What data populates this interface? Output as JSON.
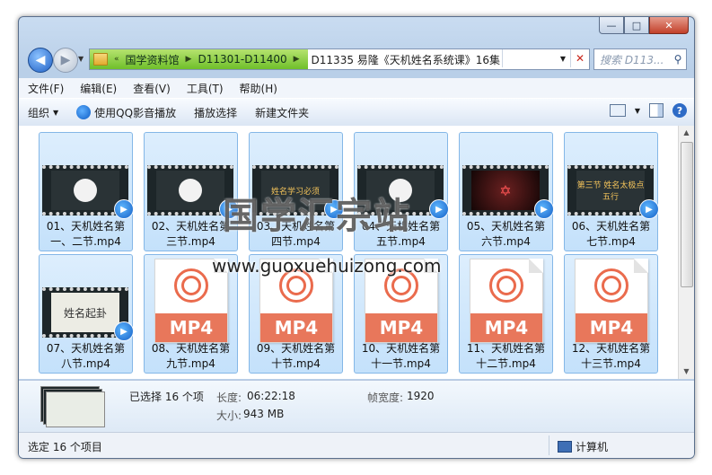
{
  "window": {
    "caption_buttons": {
      "minimize": "—",
      "maximize": "□",
      "close": "✕"
    }
  },
  "nav": {
    "back_glyph": "◀",
    "forward_glyph": "▶",
    "history_dropdown": "▼"
  },
  "address": {
    "crumbs": [
      "国学资料馆",
      "D11301-D11400"
    ],
    "prefix": "«",
    "separator": "▶",
    "current": "D11335 易隆《天机姓名系统课》16集",
    "dropdown": "▼",
    "refresh": "✕"
  },
  "search": {
    "placeholder": "搜索 D113...",
    "icon": "search-icon"
  },
  "menu": [
    "文件(F)",
    "编辑(E)",
    "查看(V)",
    "工具(T)",
    "帮助(H)"
  ],
  "toolbar": {
    "organize": "组织",
    "play_qq": "使用QQ影音播放",
    "play_selection": "播放选择",
    "new_folder": "新建文件夹",
    "caret": "▼",
    "help": "?"
  },
  "files": [
    {
      "line1": "01、天机姓名第",
      "line2": "一、二节.mp4",
      "thumb": "circle"
    },
    {
      "line1": "02、天机姓名第",
      "line2": "三节.mp4",
      "thumb": "circle"
    },
    {
      "line1": "03、天机姓名第",
      "line2": "四节.mp4",
      "thumb": "text",
      "thumb_text": "姓名学习必须"
    },
    {
      "line1": "04、天机姓名第",
      "line2": "五节.mp4",
      "thumb": "circle"
    },
    {
      "line1": "05、天机姓名第",
      "line2": "六节.mp4",
      "thumb": "star",
      "thumb_text": "✡"
    },
    {
      "line1": "06、天机姓名第",
      "line2": "七节.mp4",
      "thumb": "text",
      "thumb_text": "第三节 姓名太极点五行"
    },
    {
      "line1": "07、天机姓名第",
      "line2": "八节.mp4",
      "thumb": "light",
      "thumb_text": "姓名起卦"
    },
    {
      "line1": "08、天机姓名第",
      "line2": "九节.mp4",
      "thumb": "mp4",
      "thumb_text": "MP4"
    },
    {
      "line1": "09、天机姓名第",
      "line2": "十节.mp4",
      "thumb": "mp4",
      "thumb_text": "MP4"
    },
    {
      "line1": "10、天机姓名第",
      "line2": "十一节.mp4",
      "thumb": "mp4",
      "thumb_text": "MP4"
    },
    {
      "line1": "11、天机姓名第",
      "line2": "十二节.mp4",
      "thumb": "mp4",
      "thumb_text": "MP4"
    },
    {
      "line1": "12、天机姓名第",
      "line2": "十三节.mp4",
      "thumb": "mp4",
      "thumb_text": "MP4"
    }
  ],
  "watermark": {
    "text": "国学汇宗站",
    "url": "www.guoxuehuizong.com"
  },
  "details": {
    "selected": "已选择 16 个项",
    "length_label": "长度:",
    "length_value": "06:22:18",
    "size_label": "大小:",
    "size_value": "943 MB",
    "width_label": "帧宽度:",
    "width_value": "1920"
  },
  "status": {
    "left": "选定 16 个项目",
    "right": "计算机"
  }
}
